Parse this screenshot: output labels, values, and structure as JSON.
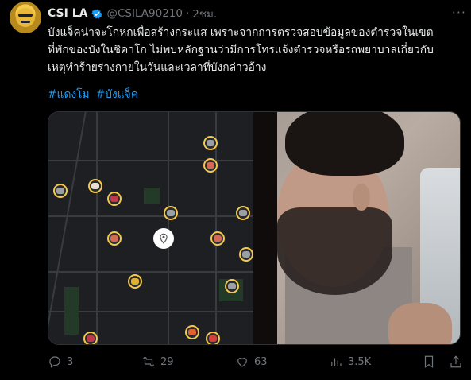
{
  "author": {
    "name": "CSI LA",
    "handle": "@CSILA90210",
    "separator": "·",
    "time": "2ชม."
  },
  "tweet": {
    "text": "บังแจ็คน่าจะโกหกเพื่อสร้างกระแส เพราะจากการตรวจสอบข้อมูลของตำรวจในเขต\nที่พักของบังในชิคาโก ไม่พบหลักฐานว่ามีการโทรแจ้งตำรวจหรือรถพยาบาลเกี่ยวกับ\nเหตุทำร้ายร่างกายในวันและเวลาที่บังกล่าวอ้าง",
    "hashtags": [
      "#แดงโม",
      "#บังแจ็ค"
    ]
  },
  "actions": {
    "replies": "3",
    "retweets": "29",
    "likes": "63",
    "views": "3.5K"
  },
  "colors": {
    "background": "#000000",
    "text": "#e7e9ea",
    "muted": "#71767b",
    "link": "#1d9bf0",
    "verified": "#1d9bf0",
    "map_pin_ring": "#f2c94c"
  },
  "icons": [
    "verified-badge-icon",
    "more-icon",
    "reply-icon",
    "retweet-icon",
    "like-icon",
    "views-icon",
    "bookmark-icon",
    "share-icon",
    "location-pin-icon"
  ]
}
